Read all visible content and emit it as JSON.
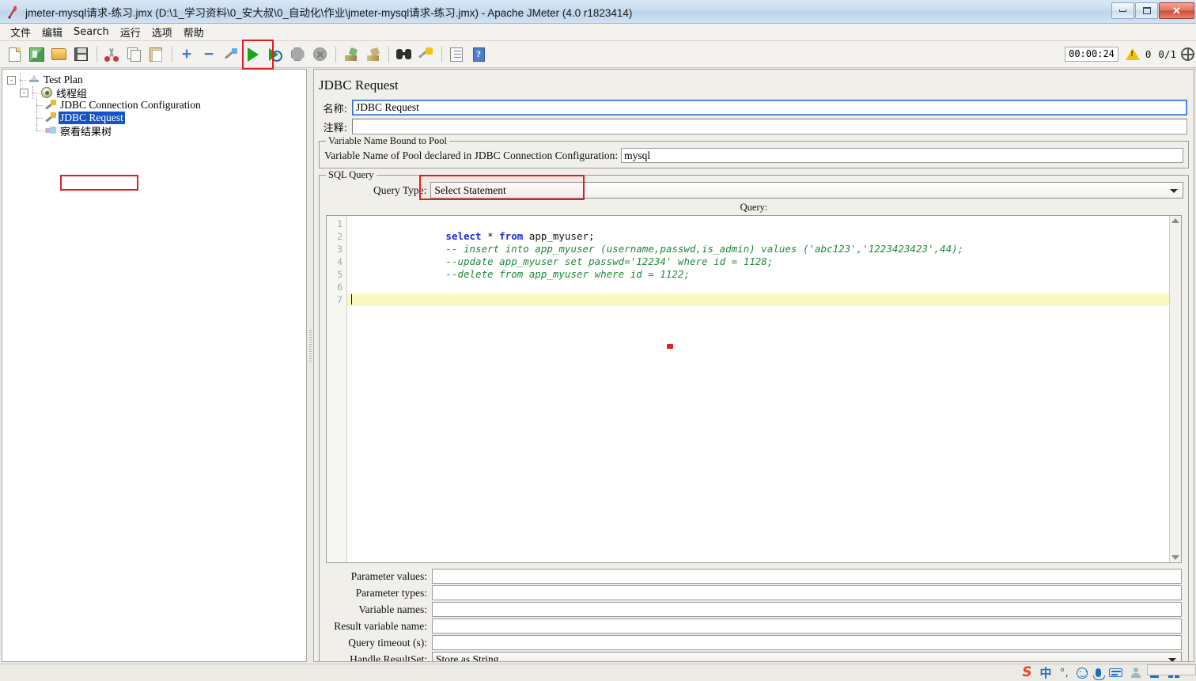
{
  "window": {
    "title": "jmeter-mysql请求-练习.jmx (D:\\1_学习资料\\0_安大叔\\0_自动化\\作业\\jmeter-mysql请求-练习.jmx) - Apache JMeter (4.0 r1823414)",
    "app_icon": "jmeter-feather-icon",
    "minimize_label": "Minimize",
    "restore_label": "Restore",
    "close_label": "✕"
  },
  "menubar": {
    "items": [
      {
        "label": "文件",
        "name": "menu-file"
      },
      {
        "label": "编辑",
        "name": "menu-edit"
      },
      {
        "label": "Search",
        "name": "menu-search"
      },
      {
        "label": "运行",
        "name": "menu-run"
      },
      {
        "label": "选项",
        "name": "menu-options"
      },
      {
        "label": "帮助",
        "name": "menu-help"
      }
    ]
  },
  "toolbar": {
    "buttons": [
      {
        "name": "new-button",
        "icon": "new-document-icon",
        "title": "New"
      },
      {
        "name": "templates-button",
        "icon": "templates-icon",
        "title": "Templates"
      },
      {
        "name": "open-button",
        "icon": "open-folder-icon",
        "title": "Open"
      },
      {
        "name": "save-button",
        "icon": "save-disk-icon",
        "title": "Save"
      },
      {
        "name": "cut-button",
        "icon": "scissors-icon",
        "title": "Cut"
      },
      {
        "name": "copy-button",
        "icon": "copy-icon",
        "title": "Copy"
      },
      {
        "name": "paste-button",
        "icon": "clipboard-icon",
        "title": "Paste"
      },
      {
        "name": "expand-button",
        "icon": "plus-icon",
        "title": "Expand All"
      },
      {
        "name": "collapse-button",
        "icon": "minus-icon",
        "title": "Collapse All"
      },
      {
        "name": "toggle-button",
        "icon": "wand-icon",
        "title": "Toggle"
      },
      {
        "name": "start-button",
        "icon": "play-green-icon",
        "title": "Start"
      },
      {
        "name": "start-no-pauses-button",
        "icon": "play-no-pauses-icon",
        "title": "Start no pauses"
      },
      {
        "name": "stop-button",
        "icon": "stop-octagon-icon",
        "title": "Stop"
      },
      {
        "name": "shutdown-button",
        "icon": "shutdown-circle-icon",
        "title": "Shutdown"
      },
      {
        "name": "clear-button",
        "icon": "broom-green-icon",
        "title": "Clear"
      },
      {
        "name": "clear-all-button",
        "icon": "broom-all-icon",
        "title": "Clear All"
      },
      {
        "name": "search-button",
        "icon": "binoculars-icon",
        "title": "Search"
      },
      {
        "name": "reset-search-button",
        "icon": "brush-clear-icon",
        "title": "Reset Search"
      },
      {
        "name": "function-helper-button",
        "icon": "function-list-icon",
        "title": "Function Helper Dialog"
      },
      {
        "name": "help-button",
        "icon": "help-book-icon",
        "title": "Help"
      }
    ],
    "status": {
      "timer": "00:00:24",
      "warning_icon": "warning-triangle-icon",
      "warning_count": "0",
      "threads": "0/1",
      "thread_indicator_icon": "thread-indicator-icon"
    }
  },
  "tree": {
    "nodes": [
      {
        "label": "Test Plan",
        "icon": "test-plan-icon",
        "name": "tree-node-test-plan",
        "selected": false,
        "depth": 0,
        "expander": "-"
      },
      {
        "label": "线程组",
        "icon": "thread-group-icon",
        "name": "tree-node-thread-group",
        "selected": false,
        "depth": 1,
        "expander": "-"
      },
      {
        "label": "JDBC Connection Configuration",
        "icon": "config-element-icon",
        "name": "tree-node-jdbc-connection-configuration",
        "selected": false,
        "depth": 2,
        "expander": ""
      },
      {
        "label": "JDBC Request",
        "icon": "sampler-icon",
        "name": "tree-node-jdbc-request",
        "selected": true,
        "depth": 2,
        "expander": ""
      },
      {
        "label": "察看结果树",
        "icon": "view-results-tree-icon",
        "name": "tree-node-view-results-tree",
        "selected": false,
        "depth": 2,
        "expander": ""
      }
    ]
  },
  "panel": {
    "title": "JDBC Request",
    "name_label": "名称:",
    "name_value": "JDBC Request",
    "comment_label": "注释:",
    "comment_value": "",
    "pool_group_title": "Variable Name Bound to Pool",
    "pool_label": "Variable Name of Pool declared in JDBC Connection Configuration:",
    "pool_value": "mysql",
    "sql_group_title": "SQL Query",
    "query_type_label": "Query Type:",
    "query_type_value": "Select Statement",
    "query_caption": "Query:",
    "editor": {
      "line_numbers": [
        "1",
        "2",
        "3",
        "4",
        "5",
        "6",
        "7"
      ],
      "active_line": 7,
      "lines": [
        {
          "n": 1,
          "tokens": [
            {
              "t": "select",
              "c": "kw"
            },
            {
              "t": " * ",
              "c": "plain"
            },
            {
              "t": "from",
              "c": "kw"
            },
            {
              "t": " app_myuser;",
              "c": "plain"
            }
          ]
        },
        {
          "n": 2,
          "tokens": [
            {
              "t": "-- insert into app_myuser (username,passwd,is_admin) values ('abc123','1223423423',44);",
              "c": "cmt"
            }
          ]
        },
        {
          "n": 3,
          "tokens": [
            {
              "t": "--update app_myuser set passwd='12234' where id = 1128;",
              "c": "cmt"
            }
          ]
        },
        {
          "n": 4,
          "tokens": [
            {
              "t": "--delete from app_myuser where id = 1122;",
              "c": "cmt"
            }
          ]
        },
        {
          "n": 5,
          "tokens": []
        },
        {
          "n": 6,
          "tokens": []
        },
        {
          "n": 7,
          "tokens": []
        }
      ]
    },
    "fields": [
      {
        "label": "Parameter values:",
        "value": "",
        "type": "text",
        "name": "parameter-values-input"
      },
      {
        "label": "Parameter types:",
        "value": "",
        "type": "text",
        "name": "parameter-types-input"
      },
      {
        "label": "Variable names:",
        "value": "",
        "type": "text",
        "name": "variable-names-input"
      },
      {
        "label": "Result variable name:",
        "value": "",
        "type": "text",
        "name": "result-variable-name-input"
      },
      {
        "label": "Query timeout (s):",
        "value": "",
        "type": "text",
        "name": "query-timeout-input"
      },
      {
        "label": "Handle ResultSet:",
        "value": "Store as String",
        "type": "combo",
        "name": "handle-resultset-combo"
      }
    ]
  },
  "annotations": {
    "colors": {
      "highlight_box": "#e02020",
      "selection": "#1453c8",
      "keyword": "#1d2ad8",
      "comment": "#1f8a3a",
      "active_line": "#fbf8c0"
    }
  },
  "ime": {
    "items": [
      {
        "name": "sogou-logo-icon",
        "label": "S"
      },
      {
        "name": "chinese-mode-icon",
        "label": "中"
      },
      {
        "name": "punctuation-icon",
        "label": "°,"
      },
      {
        "name": "emoji-icon",
        "label": ""
      },
      {
        "name": "voice-input-icon",
        "label": ""
      },
      {
        "name": "soft-keyboard-icon",
        "label": ""
      },
      {
        "name": "user-icon",
        "label": ""
      },
      {
        "name": "skin-icon",
        "label": ""
      },
      {
        "name": "toolbox-icon",
        "label": ""
      }
    ]
  }
}
